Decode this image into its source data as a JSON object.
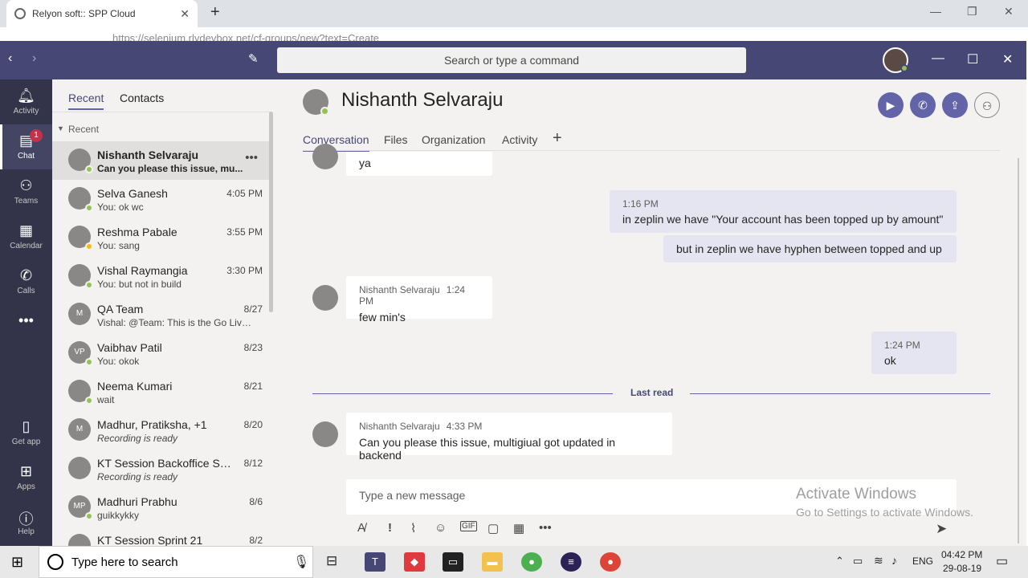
{
  "browser": {
    "tab_title": "Relyon soft:: SPP Cloud",
    "url": "https://selenium.rlydevbox.net/cf-groups/new?text=Create"
  },
  "header": {
    "search_placeholder": "Search or type a command"
  },
  "rail": [
    {
      "label": "Activity",
      "icon": "bell-icon"
    },
    {
      "label": "Chat",
      "icon": "chat-icon",
      "badge": "1"
    },
    {
      "label": "Teams",
      "icon": "teams-icon"
    },
    {
      "label": "Calendar",
      "icon": "calendar-icon"
    },
    {
      "label": "Calls",
      "icon": "phone-icon"
    },
    {
      "label": "Get app",
      "icon": "mobile-icon"
    },
    {
      "label": "Apps",
      "icon": "apps-icon"
    },
    {
      "label": "Help",
      "icon": "help-icon"
    }
  ],
  "list": {
    "tabs": [
      "Recent",
      "Contacts"
    ],
    "section": "Recent",
    "chats": [
      {
        "name": "Nishanth Selvaraju",
        "preview": "Can you please this issue, mu...",
        "time": "",
        "initials": "",
        "status": "online"
      },
      {
        "name": "Selva Ganesh",
        "preview": "You: ok wc",
        "time": "4:05 PM",
        "initials": "",
        "status": "online"
      },
      {
        "name": "Reshma Pabale",
        "preview": "You: sang",
        "time": "3:55 PM",
        "initials": "",
        "status": "away"
      },
      {
        "name": "Vishal Raymangia",
        "preview": "You: but not in build",
        "time": "3:30 PM",
        "initials": "",
        "status": "online"
      },
      {
        "name": "QA Team",
        "preview": "Vishal: @Team: This is the Go Live ...",
        "time": "8/27",
        "initials": "M",
        "status": ""
      },
      {
        "name": "Vaibhav Patil",
        "preview": "You: okok",
        "time": "8/23",
        "initials": "VP",
        "status": "online"
      },
      {
        "name": "Neema Kumari",
        "preview": "wait",
        "time": "8/21",
        "initials": "",
        "status": "online"
      },
      {
        "name": "Madhur, Pratiksha, +1",
        "preview": "Recording is ready",
        "time": "8/20",
        "initials": "M",
        "status": ""
      },
      {
        "name": "KT Session Backoffice Spri...",
        "preview": "Recording is ready",
        "time": "8/12",
        "initials": "",
        "status": ""
      },
      {
        "name": "Madhuri Prabhu",
        "preview": "guikkykky",
        "time": "8/6",
        "initials": "MP",
        "status": "online"
      },
      {
        "name": "KT Session Sprint 21",
        "preview": "",
        "time": "8/2",
        "initials": "",
        "status": ""
      }
    ]
  },
  "main": {
    "title": "Nishanth Selvaraju",
    "tabs": [
      "Conversation",
      "Files",
      "Organization",
      "Activity"
    ],
    "messages": [
      {
        "text": "ya"
      },
      {
        "time": "1:16 PM",
        "text": "in zeplin we have \"Your account has been topped up by amount\""
      },
      {
        "text": "but in zeplin we have hyphen between topped and up"
      },
      {
        "sender": "Nishanth Selvaraju",
        "time": "1:24 PM",
        "text": "few min's"
      },
      {
        "time": "1:24 PM",
        "text": "ok"
      },
      {
        "sender": "Nishanth Selvaraju",
        "time": "4:33 PM",
        "text": "Can you please this issue, multigiual got updated in backend"
      }
    ],
    "last_read": "Last read",
    "compose_placeholder": "Type a new message",
    "watermark_title": "Activate Windows",
    "watermark_sub": "Go to Settings to activate Windows."
  },
  "taskbar": {
    "search": "Type here to search",
    "lang": "ENG",
    "time": "04:42 PM",
    "date": "29-08-19"
  }
}
